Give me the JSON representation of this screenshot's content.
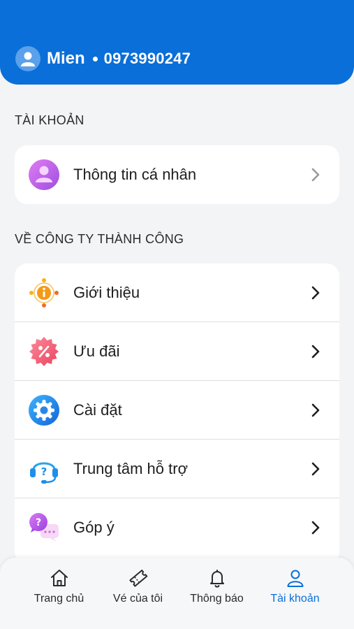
{
  "header": {
    "user_name": "Mien",
    "phone": "0973990247",
    "accent": "#0a6fd8"
  },
  "sections": {
    "account_title": "TÀI KHOẢN",
    "company_title": "VỀ CÔNG TY THÀNH CÔNG"
  },
  "account_items": [
    {
      "label": "Thông tin cá nhân",
      "icon": "person-icon"
    }
  ],
  "company_items": [
    {
      "label": "Giới thiệu",
      "icon": "info-icon"
    },
    {
      "label": "Ưu đãi",
      "icon": "discount-icon"
    },
    {
      "label": "Cài đặt",
      "icon": "gear-icon"
    },
    {
      "label": "Trung tâm hỗ trợ",
      "icon": "support-headset-icon"
    },
    {
      "label": "Góp ý",
      "icon": "feedback-chat-icon"
    }
  ],
  "tabbar": {
    "items": [
      {
        "label": "Trang chủ",
        "icon": "home-icon"
      },
      {
        "label": "Vé của tôi",
        "icon": "ticket-icon"
      },
      {
        "label": "Thông báo",
        "icon": "bell-icon"
      },
      {
        "label": "Tài khoản",
        "icon": "user-icon",
        "active": true
      }
    ]
  }
}
